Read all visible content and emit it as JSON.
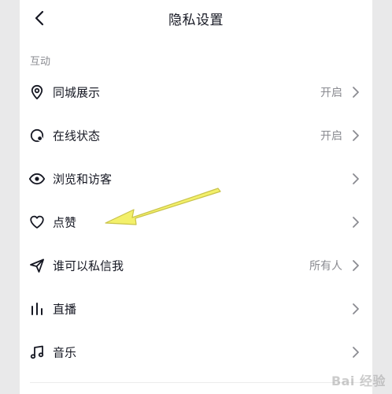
{
  "header": {
    "title": "隐私设置"
  },
  "section": {
    "label": "互动"
  },
  "rows": [
    {
      "label": "同城展示",
      "value": "开启",
      "icon": "location-pin-icon"
    },
    {
      "label": "在线状态",
      "value": "开启",
      "icon": "online-status-icon"
    },
    {
      "label": "浏览和访客",
      "value": "",
      "icon": "eye-icon"
    },
    {
      "label": "点赞",
      "value": "",
      "icon": "heart-icon"
    },
    {
      "label": "谁可以私信我",
      "value": "所有人",
      "icon": "send-icon"
    },
    {
      "label": "直播",
      "value": "",
      "icon": "live-bars-icon"
    },
    {
      "label": "音乐",
      "value": "",
      "icon": "music-note-icon"
    }
  ],
  "annotation": {
    "arrow_color": "#f3f06a"
  },
  "watermark": {
    "text": "Bai 经验"
  }
}
